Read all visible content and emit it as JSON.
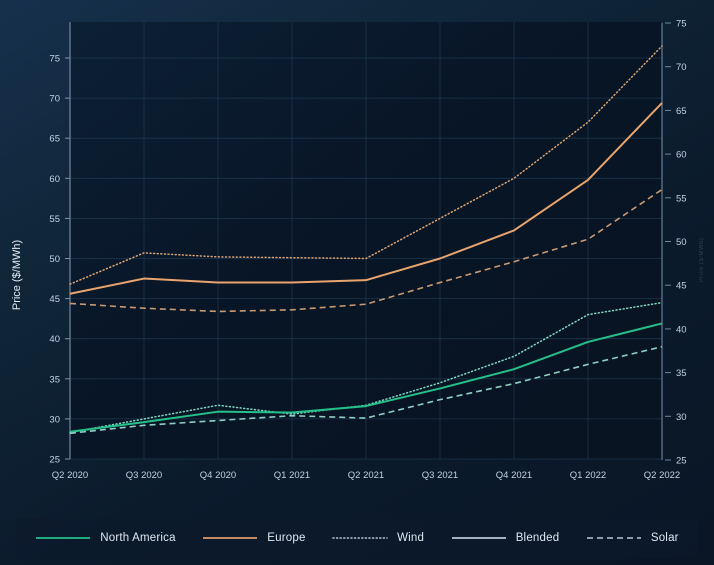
{
  "chart_data": {
    "type": "line",
    "title": "",
    "xlabel": "",
    "ylabel": "Price ($/MWh)",
    "ylabel_right": "Price ($/MWh)",
    "ylim": [
      25,
      75
    ],
    "ylim_right": [
      25,
      75
    ],
    "grid": true,
    "legend_position": "bottom",
    "categories": [
      "Q2 2020",
      "Q3 2020",
      "Q4 2020",
      "Q1 2021",
      "Q2 2021",
      "Q3 2021",
      "Q4 2021",
      "Q1 2022",
      "Q2 2022"
    ],
    "yticks": [
      25,
      30,
      35,
      40,
      45,
      50,
      55,
      60,
      65,
      70,
      75
    ],
    "yticks_right": [
      25,
      30,
      35,
      40,
      45,
      50,
      55,
      60,
      65,
      70,
      75
    ],
    "series": [
      {
        "name": "Europe Wind",
        "region": "Europe",
        "technology": "Wind",
        "style": "dotted",
        "color": "#d9a273",
        "values": [
          46.8,
          50.7,
          50.2,
          50.1,
          50.0,
          55.0,
          60.0,
          67.0,
          76.5
        ]
      },
      {
        "name": "Europe Blended",
        "region": "Europe",
        "technology": "Blended",
        "style": "solid",
        "color": "#e9a46d",
        "values": [
          45.6,
          47.5,
          47.0,
          47.0,
          47.3,
          50.0,
          53.5,
          59.8,
          69.4
        ]
      },
      {
        "name": "Europe Solar",
        "region": "Europe",
        "technology": "Solar",
        "style": "dashed",
        "color": "#c99a72",
        "values": [
          44.4,
          43.8,
          43.4,
          43.6,
          44.3,
          47.0,
          49.6,
          52.4,
          58.6
        ]
      },
      {
        "name": "North America Wind",
        "region": "North America",
        "technology": "Wind",
        "style": "dotted",
        "color": "#7fd9c2",
        "values": [
          28.3,
          30.0,
          31.7,
          30.6,
          31.7,
          34.5,
          37.8,
          43.0,
          44.5
        ]
      },
      {
        "name": "North America Blended",
        "region": "North America",
        "technology": "Blended",
        "style": "solid",
        "color": "#25c08a"
      },
      {
        "name": "North America Solar",
        "region": "North America",
        "technology": "Solar",
        "style": "dashed",
        "color": "#8fcfc3",
        "values": [
          28.2,
          29.2,
          29.8,
          30.4,
          30.1,
          32.4,
          34.4,
          36.8,
          39.0
        ]
      }
    ],
    "series_na_blended_values": [
      28.4,
      29.6,
      30.9,
      30.8,
      31.6,
      33.8,
      36.2,
      39.6,
      41.9
    ]
  },
  "axes": {
    "left_label": "Price ($/MWh)",
    "right_label": "Price ($/MWh)"
  },
  "legend": {
    "items": [
      {
        "label": "North America",
        "color": "#25c08a",
        "style": "solid",
        "icon": "line-swatch-icon"
      },
      {
        "label": "Europe",
        "color": "#e09a6a",
        "style": "solid",
        "icon": "line-swatch-icon"
      },
      {
        "label": "Wind",
        "color": "#b9c8d8",
        "style": "dotted",
        "icon": "line-swatch-icon"
      },
      {
        "label": "Blended",
        "color": "#b9c8d8",
        "style": "solid",
        "icon": "line-swatch-icon"
      },
      {
        "label": "Solar",
        "color": "#b9c8d8",
        "style": "dashed",
        "icon": "line-swatch-icon"
      }
    ]
  },
  "colors": {
    "background": "#0f2438",
    "grid": "#21384f",
    "axis": "#8ea4bb",
    "north_america": "#25c08a",
    "europe": "#e09a6a"
  }
}
